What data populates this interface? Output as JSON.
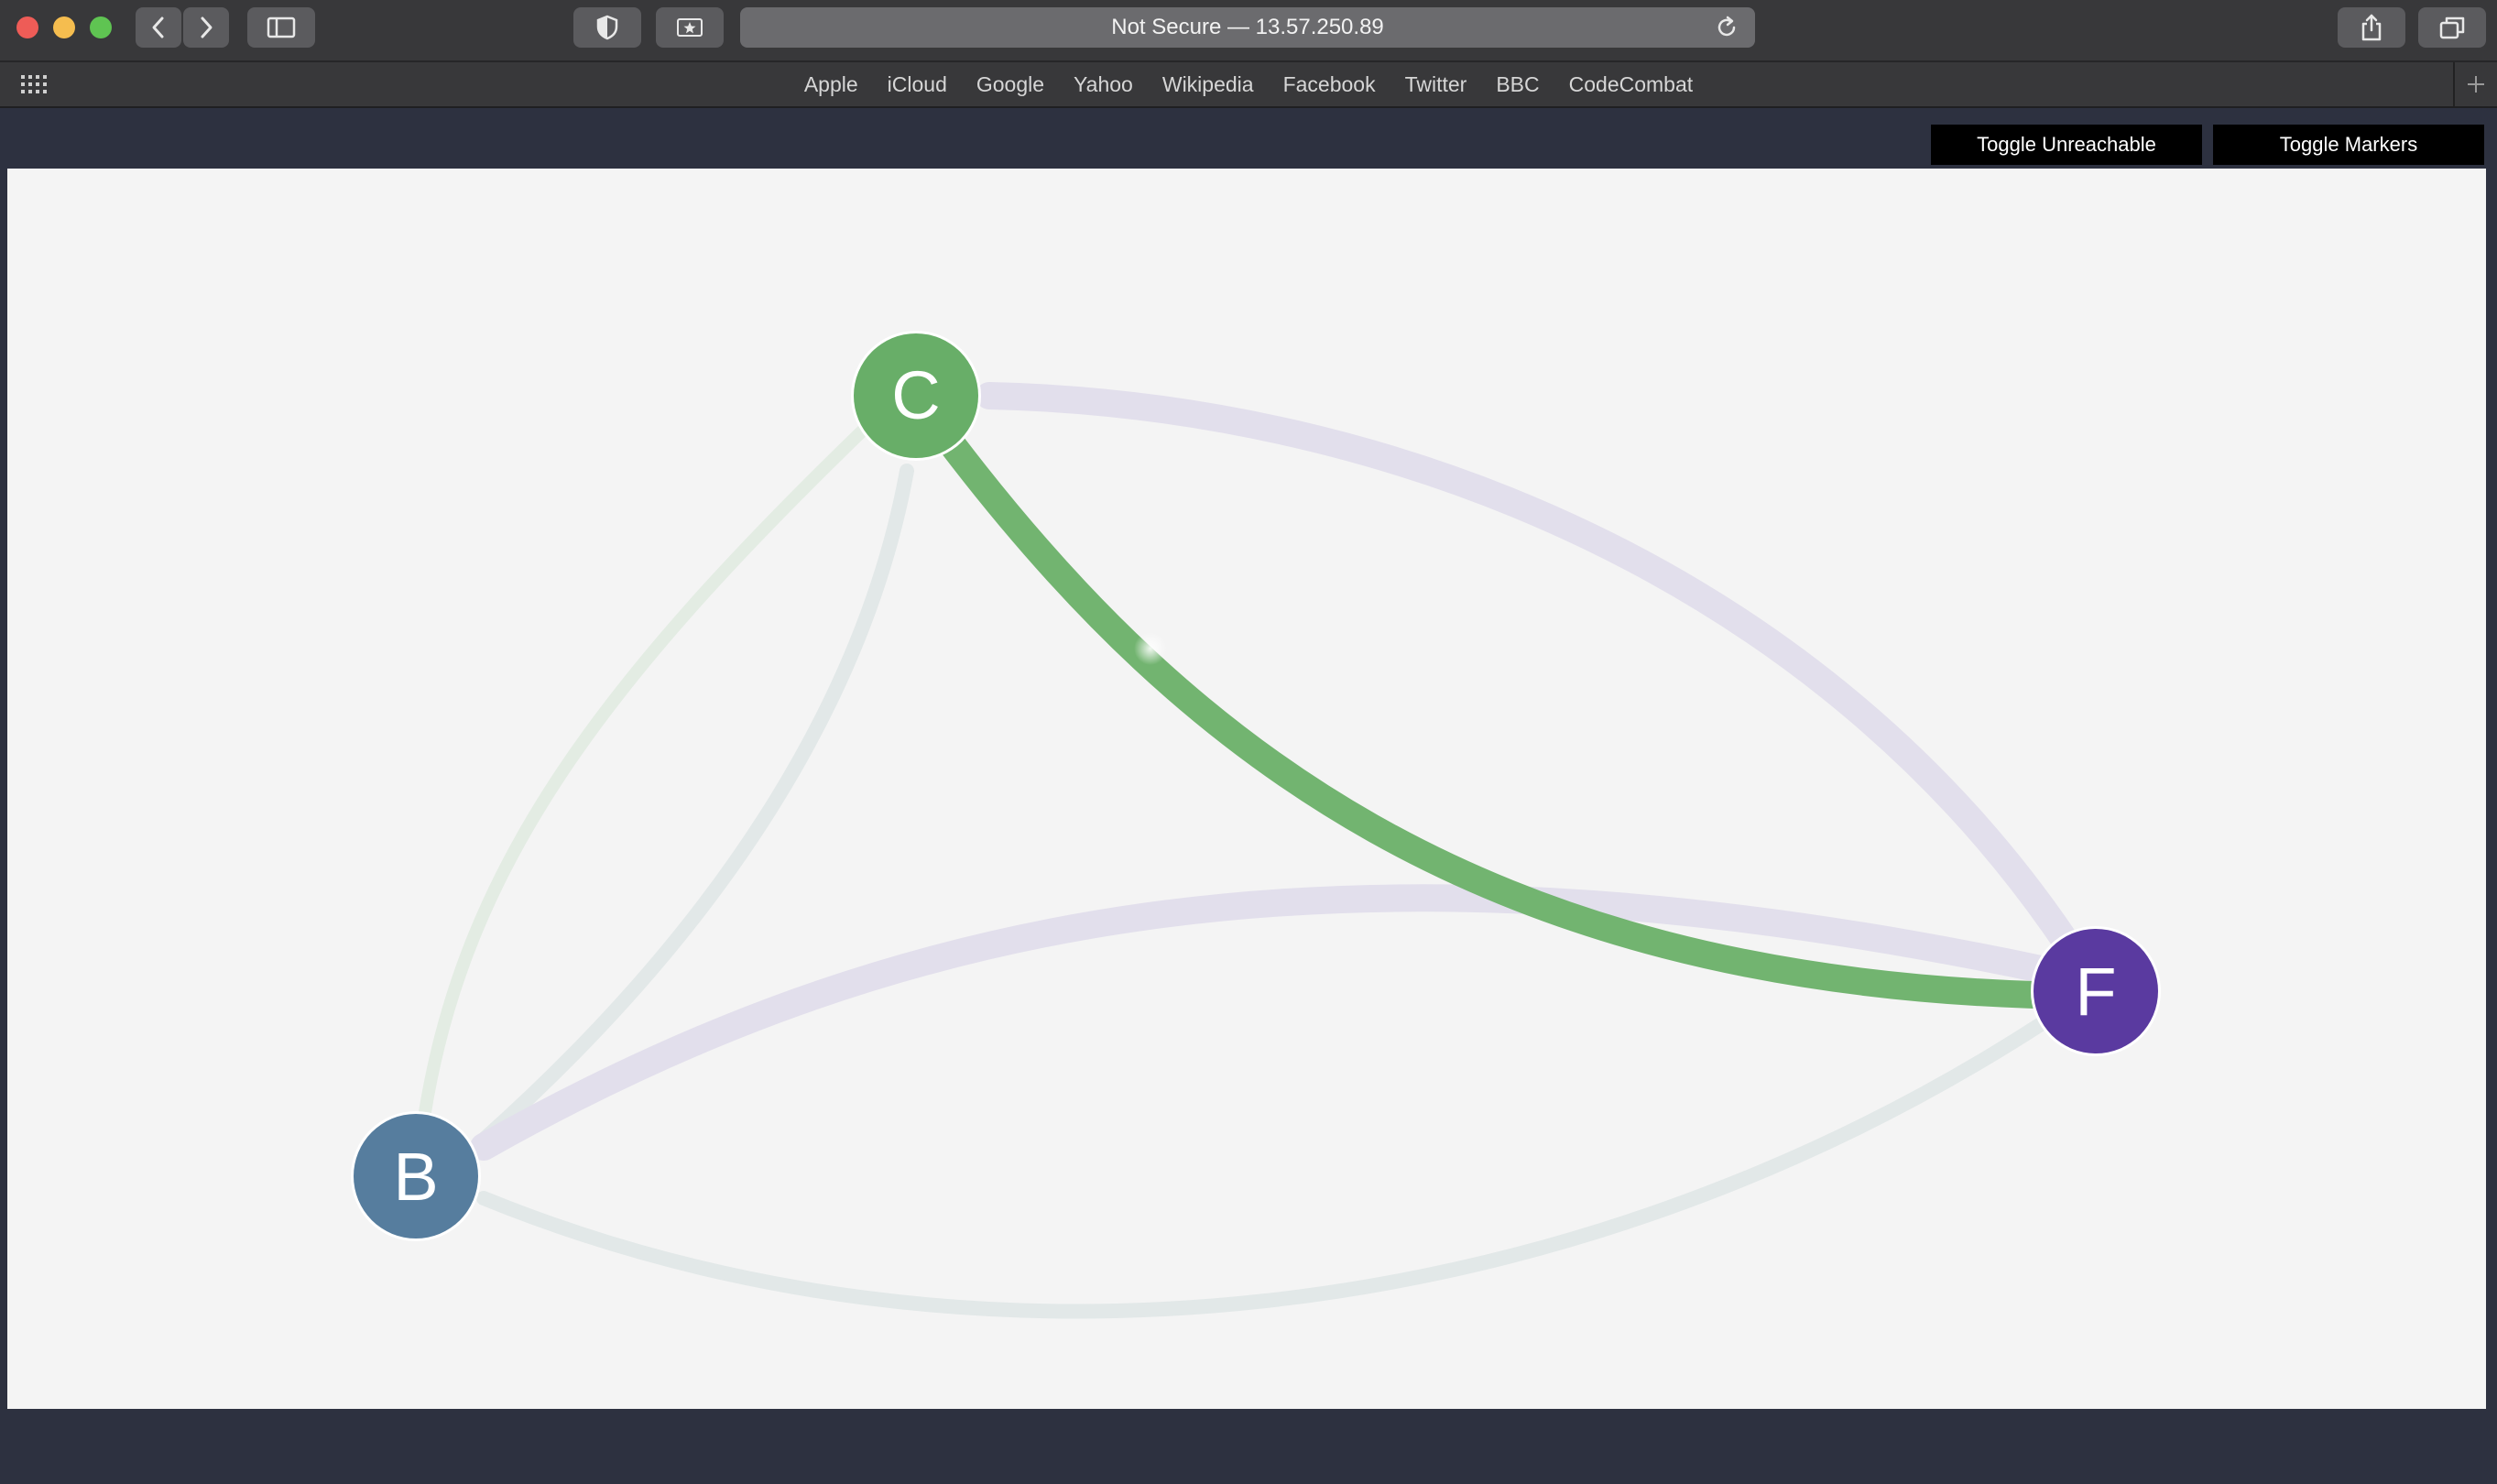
{
  "browser": {
    "address": "Not Secure — 13.57.250.89",
    "favorites": [
      "Apple",
      "iCloud",
      "Google",
      "Yahoo",
      "Wikipedia",
      "Facebook",
      "Twitter",
      "BBC",
      "CodeCombat"
    ]
  },
  "controls": {
    "toggle_unreachable": "Toggle Unreachable",
    "toggle_markers": "Toggle Markers"
  },
  "graph": {
    "nodes": [
      {
        "label": "C",
        "color": "#68ae68"
      },
      {
        "label": "B",
        "color": "#567d9e"
      },
      {
        "label": "F",
        "color": "#5a3aa0"
      }
    ],
    "colors": {
      "active_edge": "#72b470",
      "faint_purple": "#e2dfec",
      "faint_green": "#e3ece3",
      "faint_teal": "#e2e8e8"
    }
  }
}
